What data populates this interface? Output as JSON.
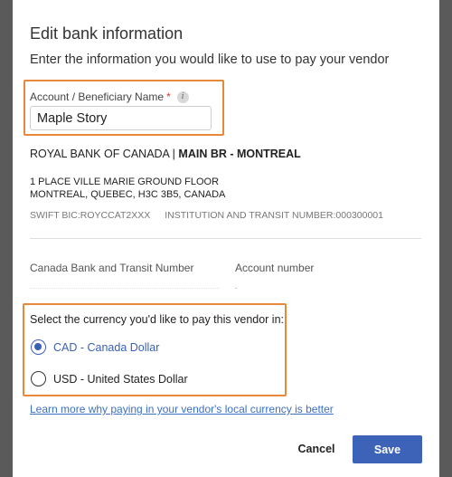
{
  "dialog": {
    "title": "Edit bank information",
    "subtitle": "Enter the information you would like to use to pay your vendor"
  },
  "beneficiary": {
    "label": "Account / Beneficiary Name",
    "required_mark": "*",
    "info_icon": "i",
    "value": "Maple Story"
  },
  "bank": {
    "name": "ROYAL BANK OF CANADA | ",
    "branch": "MAIN BR - MONTREAL",
    "address_line1": "1 PLACE VILLE MARIE GROUND FLOOR",
    "address_line2": "MONTREAL, QUEBEC, H3C 3B5, CANADA",
    "swift": "SWIFT BIC:ROYCCAT2XXX",
    "institution": "INSTITUTION AND TRANSIT NUMBER:000300001"
  },
  "fields": {
    "transit_label": "Canada Bank and Transit Number",
    "account_label": "Account number"
  },
  "currency": {
    "question": "Select the currency you'd like to pay this vendor in:",
    "options": [
      {
        "label": "CAD - Canada Dollar",
        "selected": true
      },
      {
        "label": "USD - United States Dollar",
        "selected": false
      }
    ]
  },
  "link": {
    "text": "Learn more why paying in your vendor's local currency is better"
  },
  "actions": {
    "cancel": "Cancel",
    "save": "Save"
  },
  "colors": {
    "accent": "#3d63b8",
    "highlight": "#e8883a",
    "required": "#d9342b"
  }
}
